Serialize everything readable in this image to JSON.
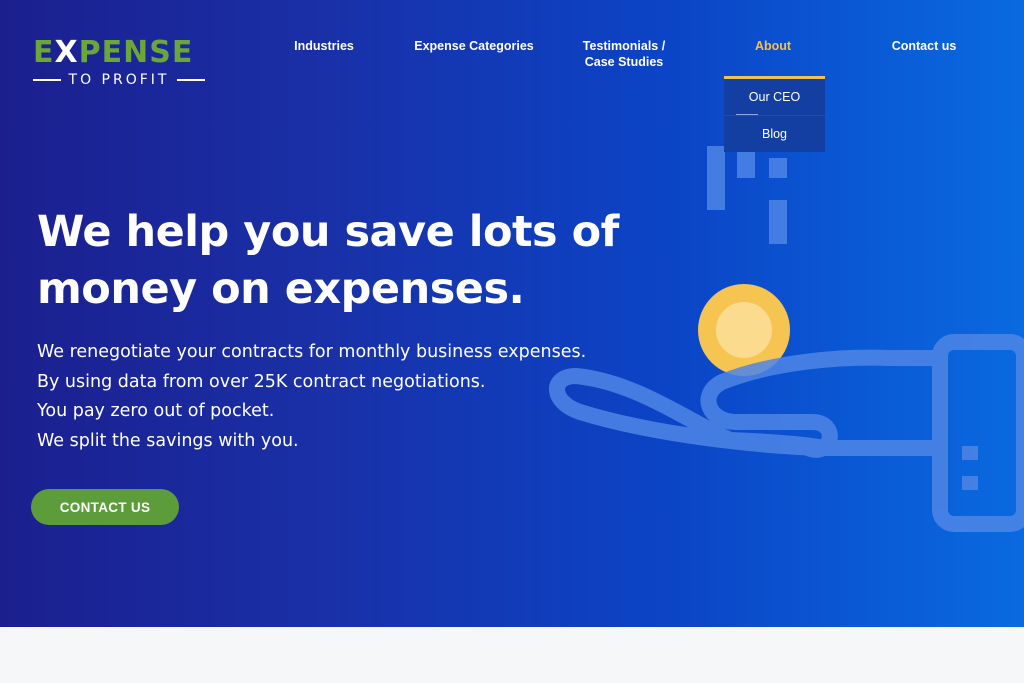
{
  "logo": {
    "main_prefix": "E",
    "main_x": "X",
    "main_suffix": "PENSE",
    "sub": "TO PROFIT"
  },
  "nav": {
    "items": [
      {
        "label": "Industries",
        "active": false
      },
      {
        "label": "Expense Categories",
        "active": false
      },
      {
        "label": "Testimonials /\nCase Studies",
        "active": false
      },
      {
        "label": "About",
        "active": true
      },
      {
        "label": "Contact us",
        "active": false
      }
    ],
    "dropdown": [
      {
        "label": "Our CEO"
      },
      {
        "label": "Blog"
      }
    ]
  },
  "hero": {
    "headline": "We help you save lots of money on expenses.",
    "lines": [
      "We renegotiate your contracts for monthly business expenses.",
      "By using data from over 25K contract negotiations.",
      "You pay zero out of pocket.",
      "We split the savings with you."
    ],
    "cta_label": "CONTACT US"
  },
  "colors": {
    "brand_green": "#6aa639",
    "cta_green": "#5d9c3a",
    "accent_gold": "#f2c14e",
    "coin": "#f5c451",
    "illustration_blue": "#4f86e6",
    "hero_gradient_start": "#1b1f8e",
    "hero_gradient_end": "#0a6ae0"
  },
  "icons": {
    "illustration": "hand-holding-coin-icon",
    "coin": "coin-icon"
  }
}
